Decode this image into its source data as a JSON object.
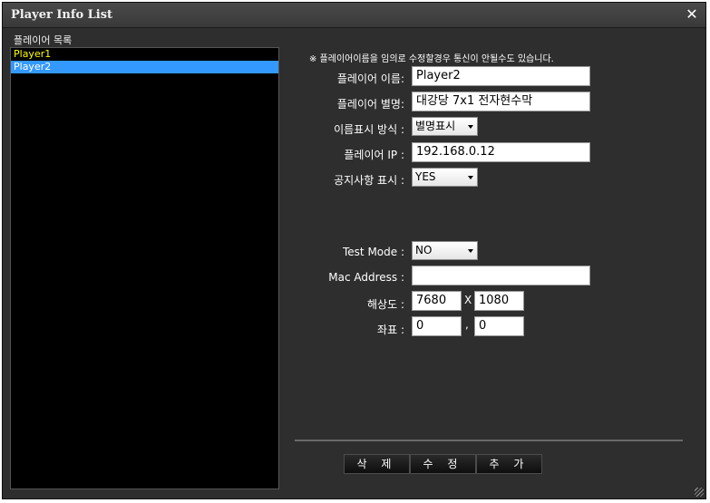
{
  "window": {
    "title": "Player Info List",
    "close_glyph": "✕"
  },
  "list": {
    "label": "플레이어 목록",
    "items": [
      {
        "label": "Player1",
        "selected": false
      },
      {
        "label": "Player2",
        "selected": true
      }
    ]
  },
  "form": {
    "notice": "※ 플레이어이름을 임의로 수정할경우 통신이 안될수도 있습니다.",
    "player_name": {
      "label": "플레이어 이름:",
      "value": "Player2"
    },
    "player_alias": {
      "label": "플레이어 별명:",
      "value": "대강당 7x1 전자현수막"
    },
    "name_display": {
      "label": "이름표시 방식 :",
      "value": "별명표시"
    },
    "player_ip": {
      "label": "플레이어 IP :",
      "value": "192.168.0.12"
    },
    "notice_display": {
      "label": "공지사항 표시 :",
      "value": "YES"
    },
    "test_mode": {
      "label": "Test Mode :",
      "value": "NO"
    },
    "mac_address": {
      "label": "Mac Address :",
      "value": ""
    },
    "resolution": {
      "label": "해상도 :",
      "width": "7680",
      "sep": "X",
      "height": "1080"
    },
    "coords": {
      "label": "좌표 :",
      "x": "0",
      "sep": ",",
      "y": "0"
    }
  },
  "buttons": {
    "delete": "삭 제",
    "edit": "수 정",
    "add": "추 가"
  },
  "colors": {
    "window_bg": "#2e2e2e",
    "list_bg": "#000000",
    "selection": "#3399ff",
    "unselected_text": "#ffff00"
  }
}
